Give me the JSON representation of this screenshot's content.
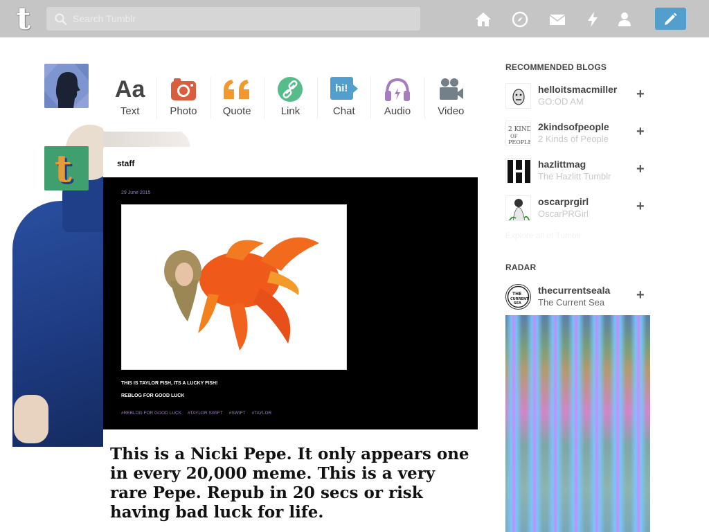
{
  "header": {
    "search_placeholder": "Search Tumblr",
    "logo_letter": "t",
    "nav": [
      "home-icon",
      "explore-icon",
      "inbox-icon",
      "activity-icon",
      "account-icon"
    ],
    "compose_icon": "pencil-icon",
    "accent": "#529ecc"
  },
  "post_types": [
    {
      "label": "Text",
      "icon": "Aa"
    },
    {
      "label": "Photo",
      "icon": "camera-icon"
    },
    {
      "label": "Quote",
      "icon": "quote-icon"
    },
    {
      "label": "Link",
      "icon": "link-icon"
    },
    {
      "label": "Chat",
      "icon": "hi!"
    },
    {
      "label": "Audio",
      "icon": "headphones-icon"
    },
    {
      "label": "Video",
      "icon": "video-camera-icon"
    }
  ],
  "post": {
    "author": "staff",
    "image_date": "29 June 2015",
    "image_line1": "THIS IS TAYLOR FISH, ITS A LUCKY FISH!",
    "image_line2": "REBLOG FOR GOOD LUCK",
    "tags": [
      "#REBLOG FOR GOOD LUCK",
      "#TAYLOR SWIFT",
      "#SWIFT",
      "#TAYLOR"
    ],
    "caption": "This is a Nicki Pepe. It only appears one in every 20,000 meme. This is a very rare Pepe. Repub in 20 secs or risk having bad luck for life."
  },
  "sidebar": {
    "recommended_heading": "RECOMMENDED BLOGS",
    "recommended": [
      {
        "name": "helloitsmacmiller",
        "title": "GO:OD AM"
      },
      {
        "name": "2kindsofpeople",
        "title": "2 Kinds of People"
      },
      {
        "name": "hazlittmag",
        "title": "The Hazlitt Tumblr"
      },
      {
        "name": "oscarprgirl",
        "title": "OscarPRGirl"
      }
    ],
    "faded_link": "Explore all of Tumblr",
    "radar_heading": "RADAR",
    "radar": {
      "name": "thecurrentseala",
      "title": "The Current Sea"
    }
  }
}
